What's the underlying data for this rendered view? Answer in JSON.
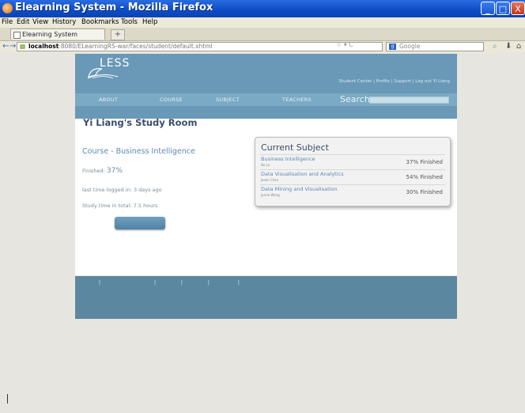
{
  "window": {
    "title": "Elearning System - Mozilla Firefox",
    "minimize": "_",
    "maximize": "□",
    "close": "X"
  },
  "menu": [
    "File",
    "Edit",
    "View",
    "History",
    "Bookmarks",
    "Tools",
    "Help"
  ],
  "tab": {
    "label": "Elearning System",
    "new_tab": "+"
  },
  "nav": {
    "back": "←",
    "forward": "→",
    "url_host": "localhost",
    "url_rest": ":8080/ELearningRS-war/faces/student/default.xhtml",
    "url_controls": "☆ ▾ C",
    "search_placeholder": "Google",
    "search_engine_icon": "google-icon"
  },
  "site": {
    "logo_text": "LESS",
    "top_links": "Student Center | Profile | Support | Log out Yi Liang",
    "nav_items": [
      "ABOUT",
      "COURSE",
      "SUBJECT",
      "TEACHERS"
    ],
    "search_label": "Search:"
  },
  "main": {
    "page_title": "Yi Liang's Study Room",
    "course_name": "Course - Business Intelligence",
    "finished_label": "Finished:",
    "finished_value": "37%",
    "last_login": "last time logged in: 3 days ago",
    "study_time": "Study time in total: 7.5 hours"
  },
  "current_subject": {
    "title": "Current Subject",
    "items": [
      {
        "name": "Business Intelligence",
        "teacher": "Bo Lu",
        "progress": "37% Finished"
      },
      {
        "name": "Data Visualisation and Analytics",
        "teacher": "Jason Chen",
        "progress": "54% Finished"
      },
      {
        "name": "Data Mining and Visualisation",
        "teacher": "Jamie Wong",
        "progress": "30% Finished"
      }
    ]
  },
  "footer": {
    "separators": [
      "|",
      "|",
      "|",
      "|",
      "|"
    ]
  },
  "colors": {
    "header": "#6a98b7",
    "nav_strip": "#7aaac4",
    "footer": "#5c87a0",
    "link": "#5a86b6"
  }
}
